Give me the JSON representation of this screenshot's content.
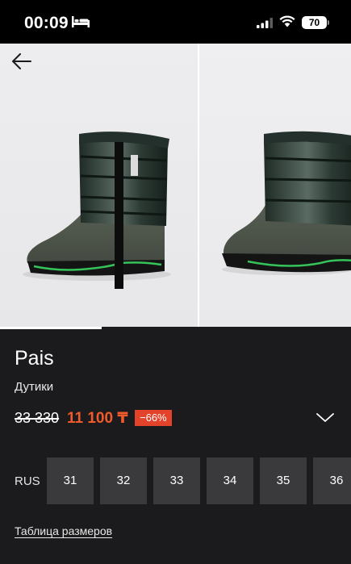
{
  "status_bar": {
    "time": "00:09",
    "battery": "70"
  },
  "product": {
    "brand": "Pais",
    "category": "Дутики",
    "old_price": "33 330",
    "new_price": "11 100 ₸",
    "discount": "−66%"
  },
  "gallery": {
    "progress": 0.29
  },
  "sizes": {
    "system": "RUS",
    "options": [
      "31",
      "32",
      "33",
      "34",
      "35",
      "36"
    ]
  },
  "size_chart_link": "Таблица размеров",
  "colors": {
    "accent": "#f15a2b",
    "badge": "#e2432a",
    "background": "#1b1b1d",
    "tile": "#3a3a3c"
  }
}
